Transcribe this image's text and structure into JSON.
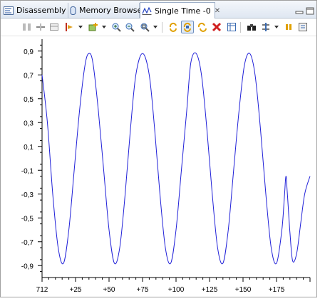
{
  "tabs": [
    {
      "label": "Disassembly",
      "icon": "disassembly-icon",
      "active": false
    },
    {
      "label": "Memory Browser",
      "icon": "memory-browser-icon",
      "active": false
    },
    {
      "label": "Single Time -0",
      "icon": "single-time-graph-icon",
      "active": true,
      "close": "✕"
    }
  ],
  "toolbar": {
    "icons": [
      "column-layout-icon",
      "split-layout-icon",
      "table-layout-icon",
      "marker-icon",
      "add-graph-icon",
      "zoom-in-icon",
      "zoom-out-icon",
      "zoom-fit-icon",
      "refresh-icon",
      "continuous-refresh-icon",
      "refresh-all-icon",
      "delete-icon",
      "table-view-icon",
      "binoculars-icon",
      "sync-icon",
      "pause-icon",
      "properties-icon"
    ]
  },
  "colors": {
    "signal": "#2020d8",
    "accent": "#6f8fbf"
  },
  "chart_data": {
    "type": "line",
    "title": "",
    "xlabel": "",
    "ylabel": "",
    "x_tick_labels": [
      "712",
      "+25",
      "+50",
      "+75",
      "+100",
      "+125",
      "+150",
      "+175"
    ],
    "y_tick_labels": [
      "0,9",
      "0,7",
      "0,5",
      "0,3",
      "0,1",
      "-0,1",
      "-0,3",
      "-0,5",
      "-0,7",
      "-0,9"
    ],
    "ylim": [
      -1.0,
      1.0
    ],
    "xlim": [
      0,
      200
    ],
    "grid": false,
    "series": [
      {
        "points": [
          [
            0,
            0.7
          ],
          [
            4,
            0.3
          ],
          [
            8,
            -0.3
          ],
          [
            12,
            -0.75
          ],
          [
            16,
            -0.88
          ],
          [
            20,
            -0.6
          ],
          [
            24,
            -0.1
          ],
          [
            28,
            0.4
          ],
          [
            32,
            0.78
          ],
          [
            35,
            0.88
          ],
          [
            38,
            0.8
          ],
          [
            42,
            0.4
          ],
          [
            46,
            -0.1
          ],
          [
            50,
            -0.6
          ],
          [
            54,
            -0.88
          ],
          [
            58,
            -0.75
          ],
          [
            62,
            -0.3
          ],
          [
            66,
            0.25
          ],
          [
            70,
            0.7
          ],
          [
            75,
            0.88
          ],
          [
            80,
            0.7
          ],
          [
            84,
            0.25
          ],
          [
            88,
            -0.3
          ],
          [
            92,
            -0.75
          ],
          [
            96,
            -0.88
          ],
          [
            100,
            -0.6
          ],
          [
            104,
            -0.1
          ],
          [
            108,
            0.4
          ],
          [
            111,
            0.8
          ],
          [
            115,
            0.88
          ],
          [
            119,
            0.7
          ],
          [
            123,
            0.25
          ],
          [
            127,
            -0.3
          ],
          [
            131,
            -0.75
          ],
          [
            135,
            -0.88
          ],
          [
            139,
            -0.6
          ],
          [
            143,
            -0.1
          ],
          [
            147,
            0.4
          ],
          [
            151,
            0.78
          ],
          [
            155,
            0.88
          ],
          [
            159,
            0.7
          ],
          [
            163,
            0.25
          ],
          [
            167,
            -0.3
          ],
          [
            171,
            -0.75
          ],
          [
            175,
            -0.88
          ],
          [
            179,
            -0.6
          ],
          [
            181,
            -0.3
          ],
          [
            182,
            -0.15
          ],
          [
            183,
            -0.28
          ],
          [
            185,
            -0.62
          ],
          [
            187,
            -0.86
          ],
          [
            190,
            -0.8
          ],
          [
            193,
            -0.55
          ],
          [
            196,
            -0.3
          ],
          [
            200,
            -0.15
          ]
        ]
      }
    ]
  }
}
